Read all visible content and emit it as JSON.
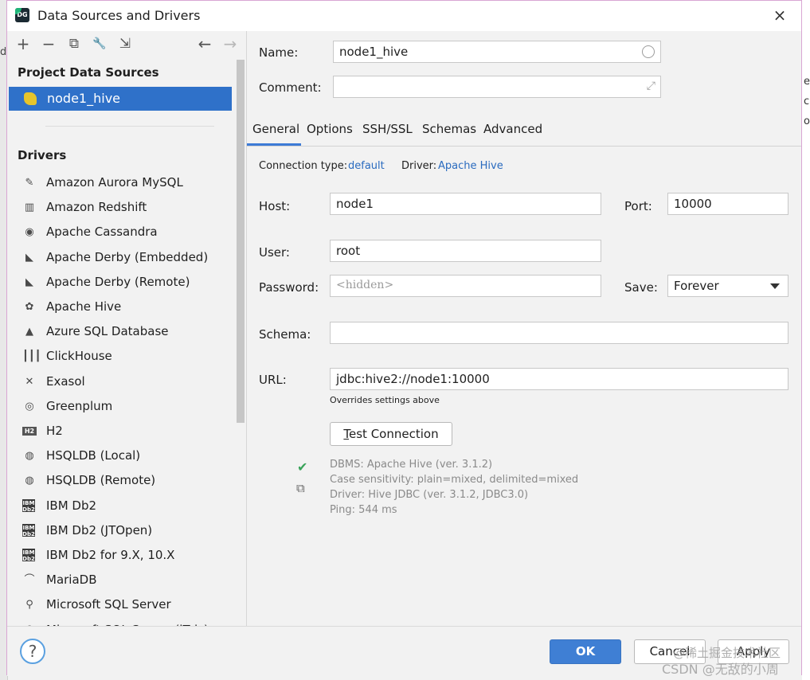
{
  "window": {
    "title": "Data Sources and Drivers",
    "close": "×"
  },
  "background": {
    "right_glimpse": [
      "e'",
      "ch",
      "ou"
    ],
    "left_glimpse": "d"
  },
  "toolbar": {
    "add": "+",
    "remove": "−",
    "duplicate": "⧉",
    "settings": "🔧",
    "import": "⇲",
    "back": "←",
    "forward": "→"
  },
  "project": {
    "heading": "Project Data Sources",
    "selected": "node1_hive"
  },
  "drivers": {
    "heading": "Drivers",
    "items": [
      {
        "label": "Amazon Aurora MySQL",
        "icon": "aurora-icon",
        "glyph": "✎"
      },
      {
        "label": "Amazon Redshift",
        "icon": "redshift-icon",
        "glyph": "▥"
      },
      {
        "label": "Apache Cassandra",
        "icon": "cassandra-icon",
        "glyph": "◉"
      },
      {
        "label": "Apache Derby (Embedded)",
        "icon": "derby-icon",
        "glyph": "◣"
      },
      {
        "label": "Apache Derby (Remote)",
        "icon": "derby-icon",
        "glyph": "◣"
      },
      {
        "label": "Apache Hive",
        "icon": "hive-icon",
        "glyph": "✿"
      },
      {
        "label": "Azure SQL Database",
        "icon": "azure-icon",
        "glyph": "▲"
      },
      {
        "label": "ClickHouse",
        "icon": "clickhouse-icon",
        "glyph": "┃┃┃"
      },
      {
        "label": "Exasol",
        "icon": "exasol-icon",
        "glyph": "✕"
      },
      {
        "label": "Greenplum",
        "icon": "greenplum-icon",
        "glyph": "◎"
      },
      {
        "label": "H2",
        "icon": "h2-icon",
        "glyph": "H2"
      },
      {
        "label": "HSQLDB (Local)",
        "icon": "hsqldb-icon",
        "glyph": "◍"
      },
      {
        "label": "HSQLDB (Remote)",
        "icon": "hsqldb-icon",
        "glyph": "◍"
      },
      {
        "label": "IBM Db2",
        "icon": "ibm-icon",
        "glyph": "IBM Db2"
      },
      {
        "label": "IBM Db2 (JTOpen)",
        "icon": "ibm-icon",
        "glyph": "IBM Db2"
      },
      {
        "label": "IBM Db2 for 9.X, 10.X",
        "icon": "ibm-icon",
        "glyph": "IBM Db2"
      },
      {
        "label": "MariaDB",
        "icon": "mariadb-icon",
        "glyph": "⌒"
      },
      {
        "label": "Microsoft SQL Server",
        "icon": "mssql-icon",
        "glyph": "⚲"
      },
      {
        "label": "Microsoft SQL Server (jTds)",
        "icon": "mssql-icon",
        "glyph": "⚲"
      }
    ]
  },
  "form": {
    "name_label": "Name:",
    "name_value": "node1_hive",
    "comment_label": "Comment:",
    "comment_value": "",
    "tabs": [
      "General",
      "Options",
      "SSH/SSL",
      "Schemas",
      "Advanced"
    ],
    "active_tab": "General",
    "connection_type_label": "Connection type:",
    "connection_type_value": "default",
    "driver_label": "Driver:",
    "driver_value": "Apache Hive",
    "host_label": "Host:",
    "host_value": "node1",
    "port_label": "Port:",
    "port_value": "10000",
    "user_label": "User:",
    "user_value": "root",
    "password_label": "Password:",
    "password_placeholder": "<hidden>",
    "save_label": "Save:",
    "save_value": "Forever",
    "schema_label": "Schema:",
    "schema_value": "",
    "url_label": "URL:",
    "url_value": "jdbc:hive2://node1:10000",
    "url_hint": "Overrides settings above",
    "test_button": "Test Connection",
    "test_button_mnemonic": "T",
    "test_button_rest": "est Connection",
    "result_lines": [
      "DBMS: Apache Hive (ver. 3.1.2)",
      "Case sensitivity: plain=mixed, delimited=mixed",
      "Driver: Hive JDBC (ver. 3.1.2, JDBC3.0)",
      "Ping: 544 ms"
    ]
  },
  "footer": {
    "help": "?",
    "ok": "OK",
    "cancel": "Cancel",
    "apply": "Apply"
  },
  "watermark": {
    "line1": "@稀土掘金技术社区",
    "line2": "CSDN @无敌的小周"
  },
  "colors": {
    "accent": "#2f71c9",
    "ok_button": "#3f7fd4",
    "link": "#2a6bbf",
    "success": "#3aa35a"
  }
}
